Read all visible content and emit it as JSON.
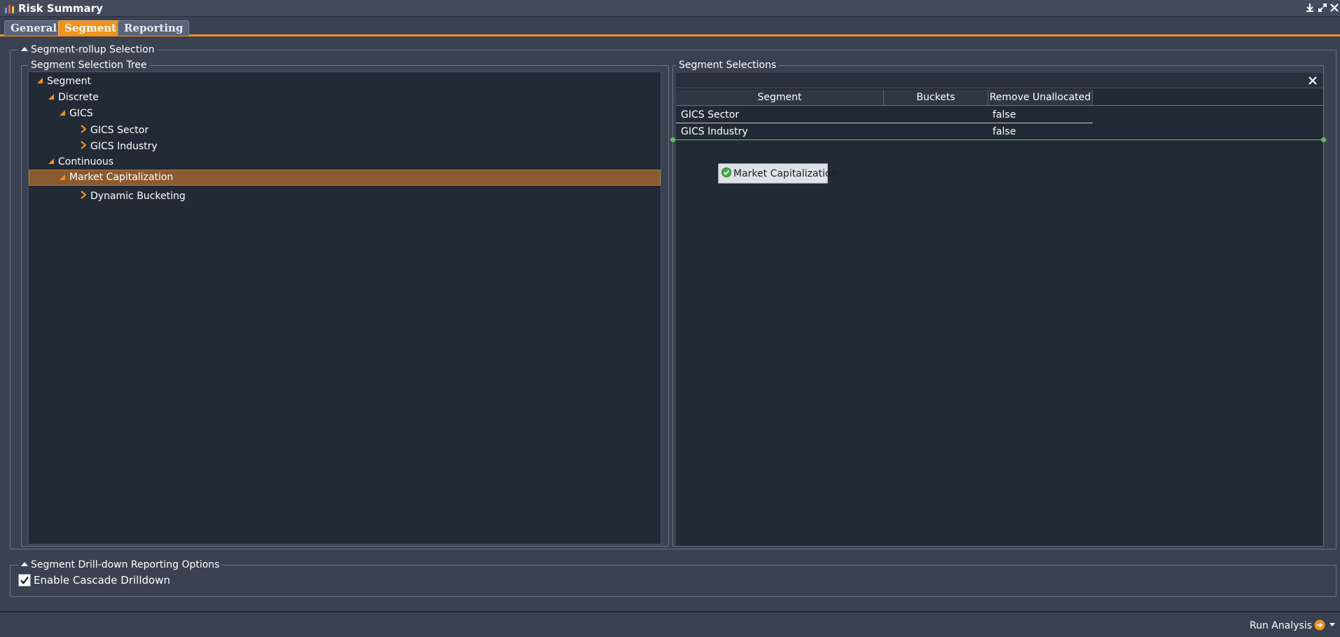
{
  "window": {
    "title": "Risk Summary"
  },
  "tabs": [
    {
      "label": "General"
    },
    {
      "label": "Segment"
    },
    {
      "label": "Reporting"
    }
  ],
  "rollup": {
    "legend": "Segment-rollup Selection",
    "tree_panel": {
      "legend": "Segment Selection Tree",
      "nodes": [
        {
          "label": "Segment"
        },
        {
          "label": "Discrete"
        },
        {
          "label": "GICS"
        },
        {
          "label": "GICS Sector"
        },
        {
          "label": "GICS Industry"
        },
        {
          "label": "Continuous"
        },
        {
          "label": "Market Capitalization"
        },
        {
          "label": "Dynamic Bucketing"
        }
      ]
    },
    "selections_panel": {
      "legend": "Segment Selections",
      "columns": [
        "Segment",
        "Buckets",
        "Remove Unallocated"
      ],
      "rows": [
        {
          "segment": "GICS Sector",
          "buckets": "",
          "remove_unallocated": "false"
        },
        {
          "segment": "GICS Industry",
          "buckets": "",
          "remove_unallocated": "false"
        }
      ],
      "drag_item": "Market Capitalization"
    }
  },
  "drilldown": {
    "legend": "Segment Drill-down Reporting Options",
    "cascade_label": "Enable Cascade Drilldown",
    "cascade_checked": true
  },
  "footer": {
    "run_label": "Run Analysis"
  },
  "colors": {
    "accent": "#f0921e",
    "background": "#3a4150",
    "panel": "#222a36",
    "selected_row": "#8a5a30"
  }
}
